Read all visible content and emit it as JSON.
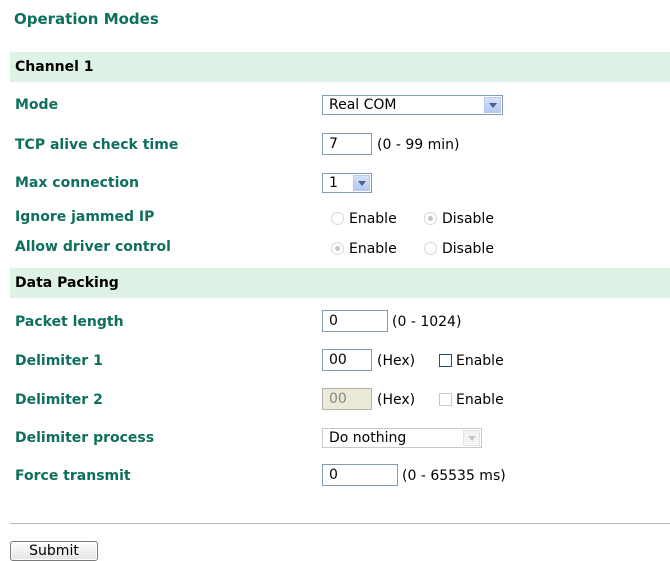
{
  "page": {
    "title": "Operation Modes"
  },
  "sections": {
    "channel": "Channel 1",
    "data_packing": "Data Packing"
  },
  "mode": {
    "label": "Mode",
    "value": "Real COM"
  },
  "tcp_alive": {
    "label": "TCP alive check time",
    "value": "7",
    "hint": "(0 - 99 min)"
  },
  "max_connection": {
    "label": "Max connection",
    "value": "1"
  },
  "ignore_jammed_ip": {
    "label": "Ignore jammed IP",
    "option_enable": "Enable",
    "option_disable": "Disable",
    "selected": "Disable"
  },
  "allow_driver_control": {
    "label": "Allow driver control",
    "option_enable": "Enable",
    "option_disable": "Disable",
    "selected": "Enable"
  },
  "packet_length": {
    "label": "Packet length",
    "value": "0",
    "hint": "(0 - 1024)"
  },
  "delimiter1": {
    "label": "Delimiter 1",
    "value": "00",
    "unit": "(Hex)",
    "enable_label": "Enable",
    "enabled": false
  },
  "delimiter2": {
    "label": "Delimiter 2",
    "value": "00",
    "unit": "(Hex)",
    "enable_label": "Enable",
    "enabled": false
  },
  "delimiter_process": {
    "label": "Delimiter process",
    "value": "Do nothing"
  },
  "force_transmit": {
    "label": "Force transmit",
    "value": "0",
    "hint": "(0 - 65535 ms)"
  },
  "submit": {
    "label": "Submit"
  },
  "colors": {
    "label_text": "#0e6f5c",
    "section_bar": "#dff2e6",
    "input_border": "#7f9db9"
  },
  "icons": {
    "dropdown": "chevron-down-icon",
    "radio": "radio-icon",
    "checkbox": "checkbox-icon"
  }
}
